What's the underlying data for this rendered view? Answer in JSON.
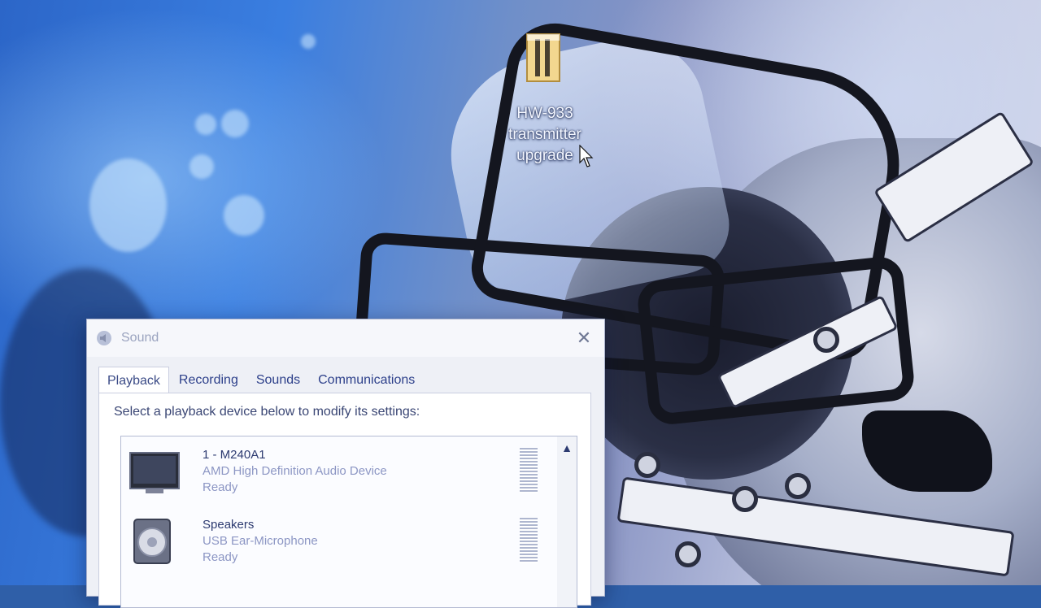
{
  "desktop": {
    "icon": {
      "label_lines": [
        "HW-933",
        "transmitter",
        "upgrade"
      ],
      "icon_name": "document-icon"
    }
  },
  "dialog": {
    "title": "Sound",
    "close_symbol": "✕",
    "tabs": [
      {
        "label": "Playback",
        "active": true
      },
      {
        "label": "Recording",
        "active": false
      },
      {
        "label": "Sounds",
        "active": false
      },
      {
        "label": "Communications",
        "active": false
      }
    ],
    "instruction": "Select a playback device below to modify its settings:",
    "devices": [
      {
        "name": "1 - M240A1",
        "description": "AMD High Definition Audio Device",
        "status": "Ready",
        "icon_name": "monitor-icon"
      },
      {
        "name": "Speakers",
        "description": "USB Ear-Microphone",
        "status": "Ready",
        "icon_name": "speaker-icon"
      }
    ],
    "scroll_up_symbol": "▲"
  },
  "colors": {
    "accent": "#2c3f8a",
    "wallpaper_blue": "#3a7ee0"
  }
}
